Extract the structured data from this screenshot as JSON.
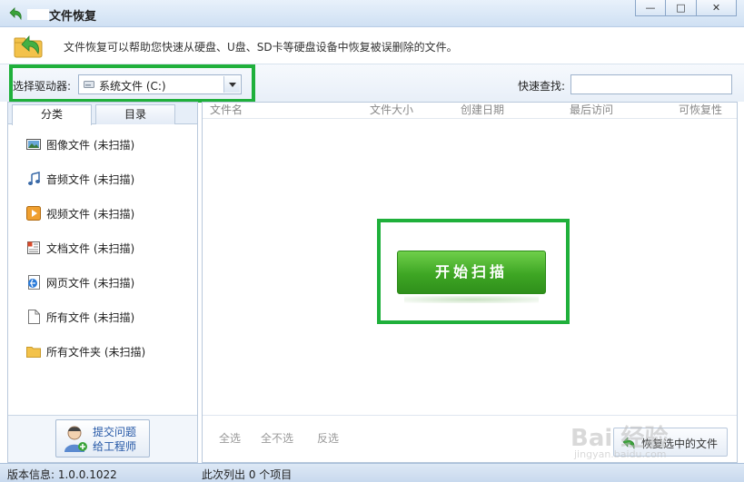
{
  "window": {
    "title": "文件恢复",
    "min_glyph": "—",
    "max_glyph": "□",
    "close_glyph": "✕"
  },
  "info": {
    "description": "文件恢复可以帮助您快速从硬盘、U盘、SD卡等硬盘设备中恢复被误删除的文件。"
  },
  "toolbar": {
    "drive_label": "选择驱动器:",
    "drive_value": "系统文件 (C:)",
    "search_label": "快速查找:",
    "search_value": ""
  },
  "left": {
    "tabs": [
      {
        "label": "分类",
        "active": true
      },
      {
        "label": "目录",
        "active": false
      }
    ],
    "categories": [
      {
        "label": "图像文件 (未扫描)",
        "icon": "image-icon"
      },
      {
        "label": "音频文件 (未扫描)",
        "icon": "music-icon"
      },
      {
        "label": "视频文件 (未扫描)",
        "icon": "video-icon"
      },
      {
        "label": "文档文件 (未扫描)",
        "icon": "document-icon"
      },
      {
        "label": "网页文件 (未扫描)",
        "icon": "webpage-icon"
      },
      {
        "label": "所有文件 (未扫描)",
        "icon": "file-icon"
      },
      {
        "label": "所有文件夹 (未扫描)",
        "icon": "folder-icon"
      }
    ],
    "engineer_button": {
      "line1": "提交问题",
      "line2": "给工程师"
    }
  },
  "main": {
    "columns": [
      "文件名",
      "文件大小",
      "创建日期",
      "最后访问",
      "可恢复性"
    ],
    "scan_button": "开始扫描",
    "select_all": "全选",
    "select_none": "全不选",
    "select_invert": "反选",
    "restore_button": "恢复选中的文件"
  },
  "status": {
    "version": "版本信息: 1.0.0.1022",
    "count": "此次列出 0 个项目"
  },
  "watermark": {
    "big": "Bai 经验",
    "small": "jingyan.baidu.com"
  },
  "colors": {
    "highlight": "#1fb03b",
    "scan_button": "#3ea624",
    "link": "#2457a6"
  }
}
